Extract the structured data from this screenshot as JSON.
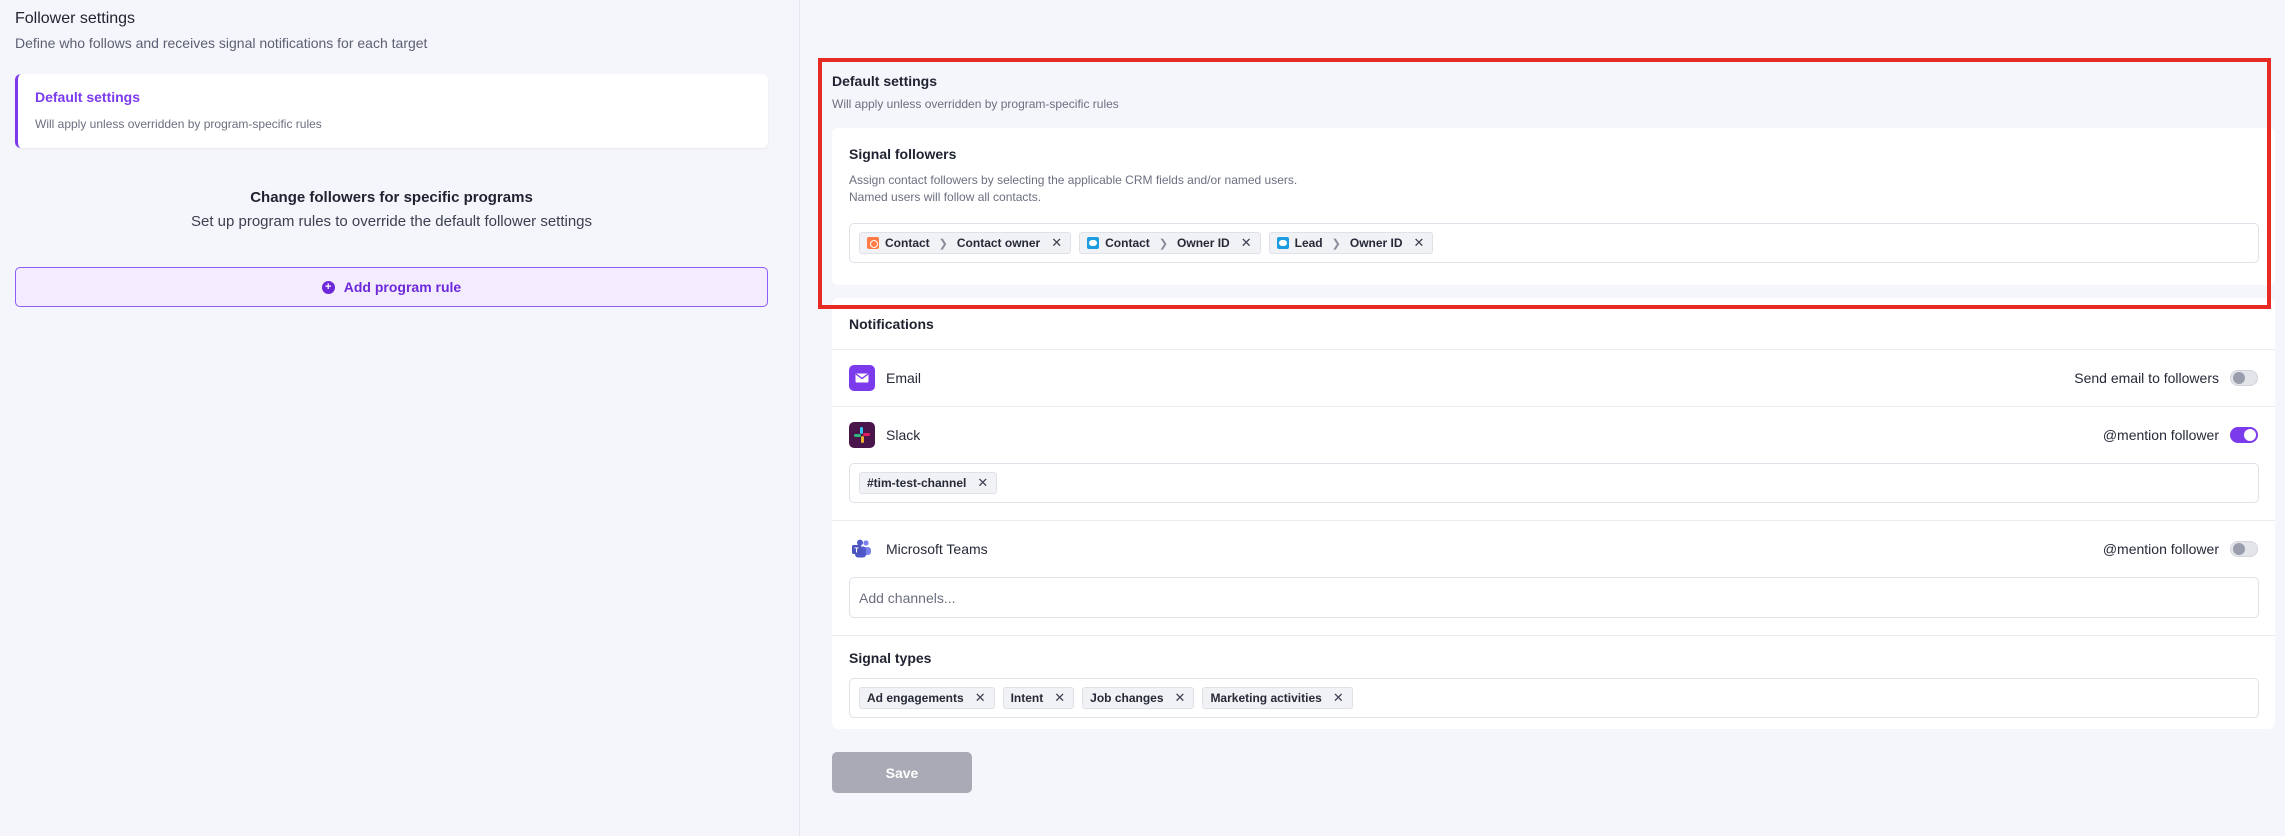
{
  "header": {
    "title": "Follower settings",
    "subtitle": "Define who follows and receives signal notifications for each target"
  },
  "left": {
    "default_card": {
      "title": "Default settings",
      "subtitle": "Will apply unless overridden by program-specific rules"
    },
    "change": {
      "title": "Change followers for specific programs",
      "subtitle": "Set up program rules to override the default follower settings"
    },
    "add_rule_label": "Add program rule"
  },
  "right": {
    "title": "Default settings",
    "subtitle": "Will apply unless overridden by program-specific rules",
    "followers": {
      "title": "Signal followers",
      "desc1": "Assign contact followers by selecting the applicable CRM fields and/or named users.",
      "desc2": "Named users will follow all contacts.",
      "chips": [
        {
          "source": "hubspot",
          "object": "Contact",
          "field": "Contact owner"
        },
        {
          "source": "salesforce",
          "object": "Contact",
          "field": "Owner ID"
        },
        {
          "source": "salesforce",
          "object": "Lead",
          "field": "Owner ID"
        }
      ]
    },
    "notifications": {
      "title": "Notifications",
      "email": {
        "label": "Email",
        "toggle_label": "Send email to followers",
        "enabled": false
      },
      "slack": {
        "label": "Slack",
        "toggle_label": "@mention follower",
        "enabled": true,
        "channels": [
          "#tim-test-channel"
        ]
      },
      "teams": {
        "label": "Microsoft Teams",
        "toggle_label": "@mention follower",
        "enabled": false,
        "placeholder": "Add channels..."
      }
    },
    "signal_types": {
      "title": "Signal types",
      "chips": [
        "Ad engagements",
        "Intent",
        "Job changes",
        "Marketing activities"
      ]
    },
    "save_label": "Save"
  },
  "colors": {
    "accent": "#7c3aed",
    "highlight": "#e52b24",
    "background": "#f5f6fb"
  }
}
